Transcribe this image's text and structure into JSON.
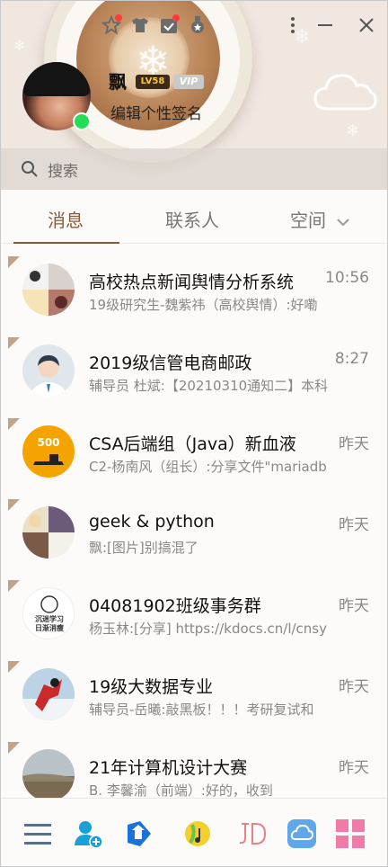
{
  "profile": {
    "nickname": "飘",
    "level_badge": "LV58",
    "vip_badge": "VIP",
    "signature": "编辑个性签名",
    "status": "online"
  },
  "search": {
    "placeholder": "搜索"
  },
  "tabs": [
    {
      "label": "消息",
      "active": true
    },
    {
      "label": "联系人",
      "active": false
    },
    {
      "label": "空间",
      "active": false
    }
  ],
  "conversations": [
    {
      "title": "高校热点新闻舆情分析系统",
      "time": "10:56",
      "preview": "19级研究生-魏紫祎（高校舆情）:好嘞"
    },
    {
      "title": "2019级信管电商邮政",
      "time": "8:27",
      "preview": "辅导员 杜斌:【20210310通知二】本科"
    },
    {
      "title": "CSA后端组（Java）新血液",
      "time": "昨天",
      "preview": "C2-杨南风（组长）:分享文件\"mariadb"
    },
    {
      "title": "geek & python",
      "time": "昨天",
      "preview": "飘:[图片]别搞混了"
    },
    {
      "title": "04081902班级事务群",
      "time": "昨天",
      "preview": "杨玉林:[分享] https://kdocs.cn/l/cnsy"
    },
    {
      "title": "19级大数据专业",
      "time": "昨天",
      "preview": "辅导员-岳曦:敲黑板！！！考研复试和"
    },
    {
      "title": "21年计算机设计大赛",
      "time": "昨天",
      "preview": "B. 李馨渝（前端）:好的，收到"
    }
  ],
  "avatar_texts": {
    "csa": "500",
    "group5_line1": "沉迷学习",
    "group5_line2": "日渐消瘦"
  },
  "colors": {
    "accent": "#8a5a3a",
    "online": "#22dd55",
    "unread_dot": "#ff3b3b"
  },
  "bottom_bar_icons": [
    "menu-icon",
    "add-contact-icon",
    "file-transfer-icon",
    "music-icon",
    "jd-icon",
    "weiyun-icon",
    "apps-icon"
  ]
}
